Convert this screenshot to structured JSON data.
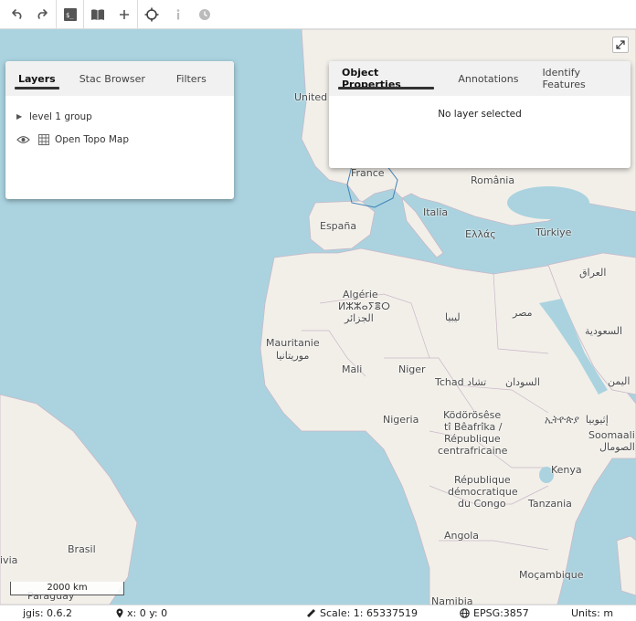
{
  "toolbar": {
    "buttons": [
      "undo-icon",
      "redo-icon",
      "terminal-icon",
      "book-icon",
      "plus-icon",
      "crosshair-icon",
      "info-icon",
      "clock-icon"
    ]
  },
  "layers_panel": {
    "tabs": [
      "Layers",
      "Stac Browser",
      "Filters"
    ],
    "active_tab": "Layers",
    "group_label": "level 1 group",
    "layer_label": "Open Topo Map"
  },
  "props_panel": {
    "tabs": [
      "Object Properties",
      "Annotations",
      "Identify Features"
    ],
    "active_tab": "Object Properties",
    "message": "No layer selected"
  },
  "map": {
    "labels": {
      "united": "United",
      "france": "France",
      "romania": "România",
      "espana": "España",
      "italia": "Italia",
      "ellas": "Ελλάς",
      "turkiye": "Türkiye",
      "iraq": "العراق",
      "algerie1": "Algérie",
      "algerie2": "ⵍⵣⵣⴰⵢⴻⵔ",
      "algerie3": "الجزائر",
      "libya": "ليبيا",
      "egypt": "مصر",
      "saudi": "السعودية",
      "mauritanie1": "Mauritanie",
      "mauritanie2": "موريتانيا",
      "mali": "Mali",
      "niger": "Niger",
      "tchad": "Tchad تشاد",
      "sudan": "السودان",
      "yemen": "اليمن",
      "nigeria": "Nigeria",
      "car1": "Ködörösêse",
      "car2": "tî Bêafrîka /",
      "car3": "République",
      "car4": "centrafricaine",
      "ethiopia": "ኢትዮጵያ ‎ إثيوبيا",
      "somalia1": "Soomaali",
      "somalia2": "الصومال",
      "kenya": "Kenya",
      "drc1": "République",
      "drc2": "démocratique",
      "drc3": "du Congo",
      "tanzania": "Tanzania",
      "angola": "Angola",
      "brasil": "Brasil",
      "bolivia": "ivia",
      "paraguay": "Paraguay",
      "mozambique": "Moçambique",
      "namibia": "Namibia"
    }
  },
  "scalebar": {
    "label": "2000 km"
  },
  "statusbar": {
    "version": "jgis: 0.6.2",
    "coords": "x: 0 y: 0",
    "scale": "Scale: 1: 65337519",
    "projection": "EPSG:3857",
    "units": "Units: m"
  }
}
